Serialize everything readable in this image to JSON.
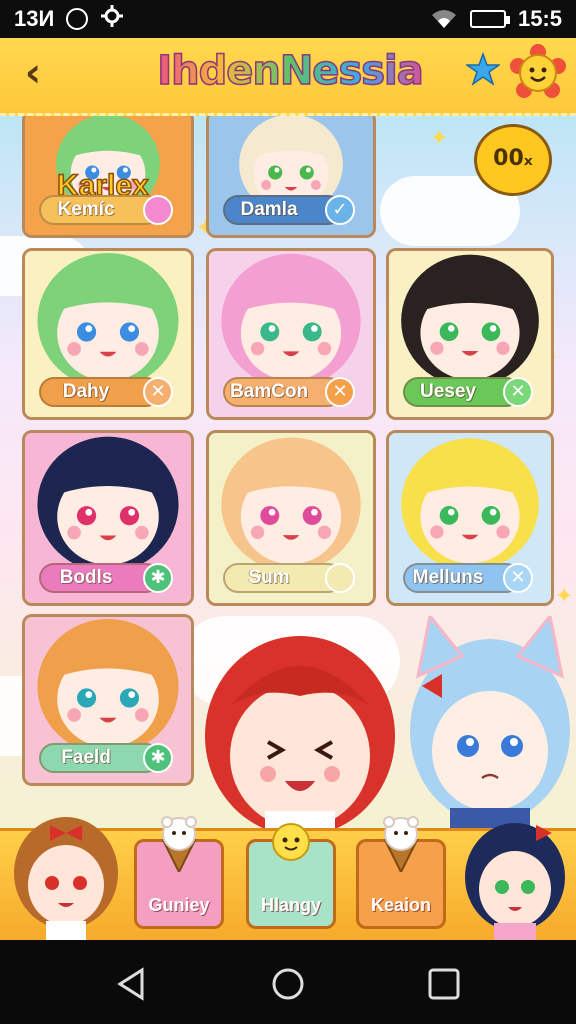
{
  "status_bar": {
    "left_text": "13И",
    "time": "15:5"
  },
  "header": {
    "title": "IhdenNessia"
  },
  "speech_bubble": {
    "text": "00ₓ"
  },
  "banner": {
    "text": "Karlex"
  },
  "cards": [
    {
      "name": "Kemíc",
      "button": "",
      "pill_color": "#f6c05a",
      "btn_color": "#f58ad0",
      "bg": "#f5a34a",
      "hair": "#7ed37a",
      "eyes": "#3a8de0"
    },
    {
      "name": "Damla",
      "button": "✓",
      "pill_color": "#4a86c9",
      "btn_color": "#6ab3e8",
      "bg": "#9bc5ea",
      "hair": "#f5ead0",
      "eyes": "#4ab84a"
    },
    {
      "name": "Dahy",
      "button": "✕",
      "pill_color": "#f0a04a",
      "btn_color": "#f5b070",
      "bg": "#fbf1c0",
      "hair": "#7ed37a",
      "eyes": "#3a8de0"
    },
    {
      "name": "BamCon",
      "button": "✕",
      "pill_color": "#f5b070",
      "btn_color": "#f5a04a",
      "bg": "#f6d2ea",
      "hair": "#f49fd2",
      "eyes": "#3ab88a"
    },
    {
      "name": "Uesey",
      "button": "✕",
      "pill_color": "#6ac75a",
      "btn_color": "#7ad77a",
      "bg": "#fbf0c4",
      "hair": "#2a2220",
      "eyes": "#3ab85a"
    },
    {
      "name": "Bodls",
      "button": "✱",
      "pill_color": "#ec7bbd",
      "btn_color": "#4ec27a",
      "bg": "#f6b6d4",
      "hair": "#1c2650",
      "eyes": "#e0306a"
    },
    {
      "name": "Sum",
      "button": "",
      "pill_color": "#f2eab0",
      "btn_color": "#f2eab0",
      "bg": "#f4f1c8",
      "hair": "#f7c48c",
      "eyes": "#e04a9a"
    },
    {
      "name": "Melluns",
      "button": "✕",
      "pill_color": "#8ec4ef",
      "btn_color": "#a9d6f4",
      "bg": "#cfe7f6",
      "hair": "#f7e04a",
      "eyes": "#3ab85a"
    },
    {
      "name": "Faeld",
      "button": "✱",
      "pill_color": "#8ed8b0",
      "btn_color": "#4ec27a",
      "bg": "#f7c2d4",
      "hair": "#f0a04a",
      "eyes": "#2aa8b8"
    }
  ],
  "shelf": {
    "tabs": [
      {
        "label": "Guniey",
        "bg": "#f49fc2"
      },
      {
        "label": "Hlangy",
        "bg": "#a9e3c7"
      },
      {
        "label": "Keaion",
        "bg": "#f5a04a"
      }
    ]
  }
}
